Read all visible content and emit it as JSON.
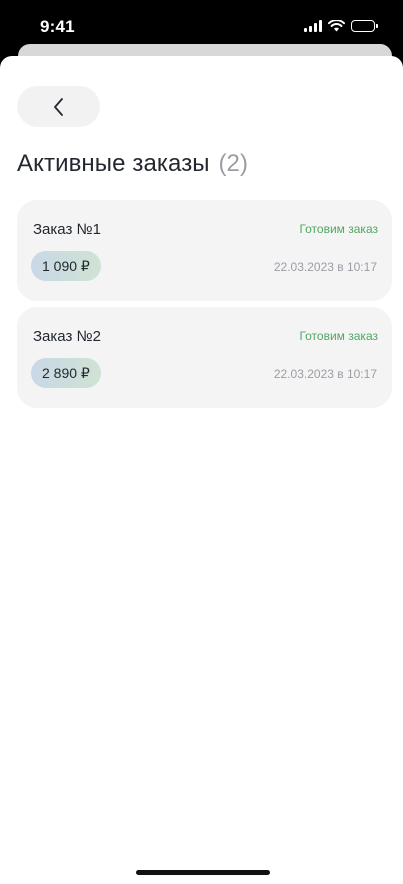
{
  "status_bar": {
    "time": "9:41",
    "icons": [
      "cellular-signal-icon",
      "wifi-icon",
      "battery-icon"
    ]
  },
  "header": {
    "back_icon": "chevron-left-icon",
    "title": "Активные заказы",
    "count": "(2)"
  },
  "orders": [
    {
      "name": "Заказ №1",
      "status": "Готовим заказ",
      "price": "1 090 ₽",
      "date": "22.03.2023 в 10:17"
    },
    {
      "name": "Заказ №2",
      "status": "Готовим заказ",
      "price": "2 890 ₽",
      "date": "22.03.2023 в 10:17"
    }
  ],
  "colors": {
    "status_text": "#4ea861",
    "card_background": "#f4f4f4",
    "price_badge_from": "#c9d8e6",
    "price_badge_to": "#cfe3d3",
    "title_text": "#232830",
    "muted_text": "#9a9ea4"
  }
}
